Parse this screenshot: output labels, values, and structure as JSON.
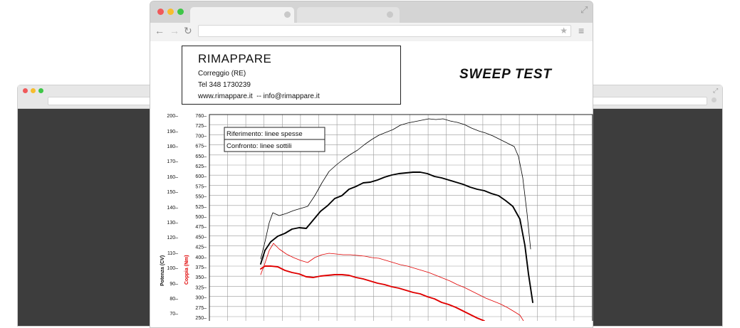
{
  "browser": {
    "tabs": [
      {
        "label": ""
      },
      {
        "label": ""
      }
    ],
    "url": ""
  },
  "report": {
    "company": {
      "name": "RIMAPPARE",
      "city": "Correggio (RE)",
      "phone": "Tel 348 1730239",
      "web_email": "www.rimappare.it  -- info@rimappare.it"
    },
    "title": "SWEEP TEST"
  },
  "chart_data": {
    "type": "line",
    "legend": [
      "Riferimento: linee spesse",
      "Confronto: linee sottili"
    ],
    "y_left_label": "Potenza (CV)",
    "y_right_label": "Coppia (Nm)",
    "y_left_ticks": [
      200,
      190,
      180,
      170,
      160,
      150,
      140,
      130,
      120,
      110,
      100,
      90,
      80,
      70
    ],
    "y_right_ticks": [
      760,
      725,
      700,
      675,
      650,
      625,
      600,
      575,
      550,
      525,
      500,
      475,
      450,
      425,
      400,
      375,
      350,
      325,
      300,
      275,
      250
    ],
    "ylim_left": [
      60,
      200
    ],
    "colors": {
      "power": "#000000",
      "torque": "#e00000"
    },
    "series": [
      {
        "role": "power_reference",
        "style": "thick",
        "color": "#000000",
        "points": [
          [
            366,
            371
          ],
          [
            372,
            352
          ],
          [
            380,
            340
          ],
          [
            390,
            332
          ],
          [
            400,
            328
          ],
          [
            410,
            322
          ],
          [
            420,
            320
          ],
          [
            430,
            321
          ],
          [
            440,
            309
          ],
          [
            450,
            297
          ],
          [
            460,
            289
          ],
          [
            470,
            279
          ],
          [
            480,
            275
          ],
          [
            490,
            266
          ],
          [
            500,
            262
          ],
          [
            510,
            257
          ],
          [
            520,
            256
          ],
          [
            530,
            253
          ],
          [
            540,
            249
          ],
          [
            550,
            246
          ],
          [
            560,
            244
          ],
          [
            570,
            243
          ],
          [
            580,
            242
          ],
          [
            590,
            242
          ],
          [
            600,
            244
          ],
          [
            610,
            248
          ],
          [
            620,
            250
          ],
          [
            630,
            253
          ],
          [
            640,
            256
          ],
          [
            650,
            259
          ],
          [
            660,
            263
          ],
          [
            670,
            266
          ],
          [
            680,
            268
          ],
          [
            690,
            272
          ],
          [
            700,
            275
          ],
          [
            710,
            282
          ],
          [
            720,
            290
          ],
          [
            730,
            308
          ],
          [
            737,
            345
          ],
          [
            742,
            385
          ],
          [
            748,
            425
          ]
        ]
      },
      {
        "role": "power_compare",
        "style": "thin",
        "color": "#000000",
        "points": [
          [
            366,
            364
          ],
          [
            372,
            340
          ],
          [
            378,
            313
          ],
          [
            383,
            299
          ],
          [
            392,
            303
          ],
          [
            402,
            300
          ],
          [
            412,
            296
          ],
          [
            422,
            293
          ],
          [
            432,
            290
          ],
          [
            442,
            275
          ],
          [
            452,
            257
          ],
          [
            462,
            241
          ],
          [
            472,
            232
          ],
          [
            482,
            224
          ],
          [
            492,
            217
          ],
          [
            502,
            211
          ],
          [
            512,
            203
          ],
          [
            522,
            196
          ],
          [
            532,
            190
          ],
          [
            542,
            186
          ],
          [
            552,
            182
          ],
          [
            562,
            176
          ],
          [
            572,
            173
          ],
          [
            582,
            171
          ],
          [
            592,
            169
          ],
          [
            602,
            167
          ],
          [
            612,
            168
          ],
          [
            622,
            167
          ],
          [
            632,
            170
          ],
          [
            642,
            172
          ],
          [
            652,
            175
          ],
          [
            662,
            180
          ],
          [
            672,
            184
          ],
          [
            682,
            187
          ],
          [
            692,
            191
          ],
          [
            702,
            196
          ],
          [
            712,
            201
          ],
          [
            722,
            206
          ],
          [
            728,
            220
          ],
          [
            734,
            250
          ],
          [
            740,
            300
          ],
          [
            745,
            350
          ]
        ]
      },
      {
        "role": "torque_reference",
        "style": "thick",
        "color": "#e00000",
        "points": [
          [
            366,
            378
          ],
          [
            372,
            374
          ],
          [
            380,
            374
          ],
          [
            390,
            375
          ],
          [
            400,
            380
          ],
          [
            410,
            383
          ],
          [
            420,
            385
          ],
          [
            430,
            389
          ],
          [
            440,
            390
          ],
          [
            450,
            388
          ],
          [
            460,
            387
          ],
          [
            470,
            386
          ],
          [
            480,
            386
          ],
          [
            490,
            387
          ],
          [
            500,
            390
          ],
          [
            510,
            392
          ],
          [
            520,
            395
          ],
          [
            530,
            398
          ],
          [
            540,
            400
          ],
          [
            550,
            403
          ],
          [
            560,
            405
          ],
          [
            570,
            408
          ],
          [
            580,
            411
          ],
          [
            590,
            413
          ],
          [
            600,
            417
          ],
          [
            610,
            420
          ],
          [
            620,
            425
          ],
          [
            630,
            428
          ],
          [
            640,
            432
          ],
          [
            650,
            437
          ],
          [
            660,
            442
          ],
          [
            670,
            447
          ],
          [
            680,
            451
          ]
        ]
      },
      {
        "role": "torque_compare",
        "style": "thin",
        "color": "#e00000",
        "points": [
          [
            366,
            386
          ],
          [
            372,
            370
          ],
          [
            378,
            352
          ],
          [
            384,
            342
          ],
          [
            392,
            350
          ],
          [
            402,
            357
          ],
          [
            412,
            362
          ],
          [
            422,
            366
          ],
          [
            432,
            369
          ],
          [
            442,
            362
          ],
          [
            452,
            358
          ],
          [
            462,
            356
          ],
          [
            472,
            357
          ],
          [
            482,
            358
          ],
          [
            492,
            358
          ],
          [
            502,
            359
          ],
          [
            512,
            360
          ],
          [
            522,
            362
          ],
          [
            532,
            363
          ],
          [
            542,
            366
          ],
          [
            552,
            369
          ],
          [
            562,
            372
          ],
          [
            572,
            374
          ],
          [
            582,
            377
          ],
          [
            592,
            380
          ],
          [
            602,
            383
          ],
          [
            612,
            387
          ],
          [
            622,
            391
          ],
          [
            632,
            395
          ],
          [
            642,
            400
          ],
          [
            652,
            404
          ],
          [
            662,
            409
          ],
          [
            672,
            414
          ],
          [
            682,
            419
          ],
          [
            692,
            423
          ],
          [
            702,
            427
          ],
          [
            712,
            432
          ],
          [
            722,
            438
          ],
          [
            730,
            443
          ],
          [
            735,
            451
          ]
        ]
      }
    ]
  }
}
